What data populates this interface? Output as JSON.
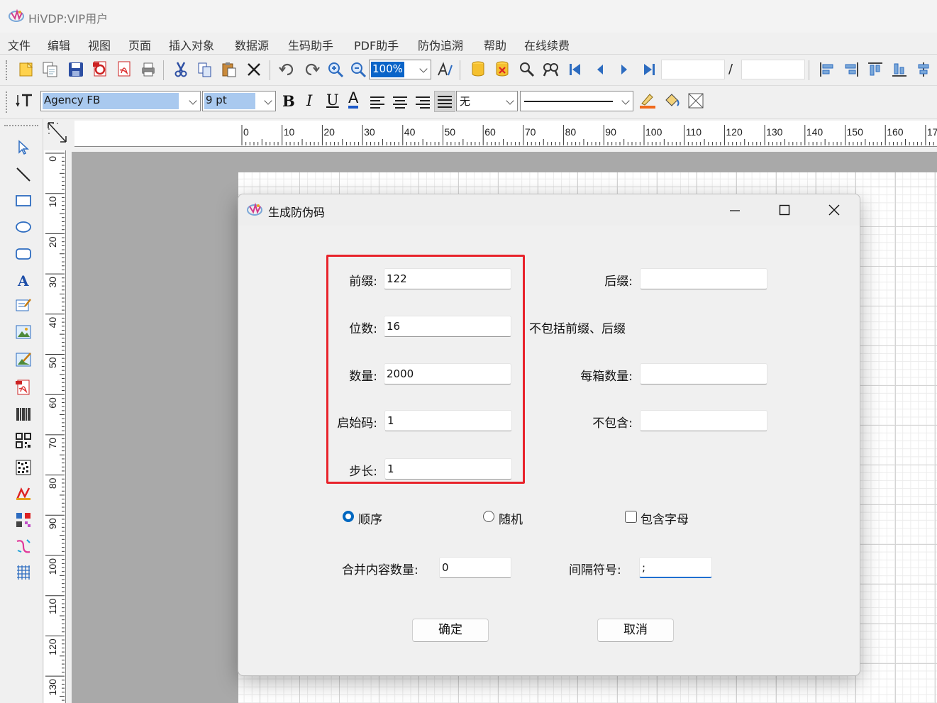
{
  "app": {
    "title": "HiVDP:VIP用户"
  },
  "menu": [
    "文件",
    "编辑",
    "视图",
    "页面",
    "插入对象",
    "数据源",
    "生码助手",
    "PDF助手",
    "防伪追溯",
    "帮助",
    "在线续费"
  ],
  "toolbar": {
    "zoom": "100%",
    "page_separator": "/",
    "font_name": "Agency FB",
    "font_size": "9 pt",
    "bold": "B",
    "italic": "I",
    "underline": "U",
    "font_color": "A",
    "border_style": "无"
  },
  "ruler": {
    "horizontal": [
      "0",
      "10",
      "20",
      "30",
      "40",
      "50",
      "60",
      "70",
      "80",
      "90",
      "100",
      "110",
      "120",
      "130",
      "140",
      "150",
      "160",
      "17"
    ],
    "vertical": [
      "0",
      "10",
      "20",
      "30",
      "40",
      "50",
      "60",
      "70",
      "80",
      "90",
      "100",
      "110",
      "120",
      "130"
    ]
  },
  "dialog": {
    "title": "生成防伪码",
    "prefix_label": "前缀:",
    "prefix_value": "122",
    "suffix_label": "后缀:",
    "suffix_value": "",
    "digits_label": "位数:",
    "digits_value": "16",
    "digits_note": "不包括前缀、后缀",
    "quantity_label": "数量:",
    "quantity_value": "2000",
    "per_box_label": "每箱数量:",
    "per_box_value": "",
    "start_label": "启始码:",
    "start_value": "1",
    "exclude_label": "不包含:",
    "exclude_value": "",
    "step_label": "步长:",
    "step_value": "1",
    "order_sequential": "顺序",
    "order_random": "随机",
    "include_letters": "包含字母",
    "merge_label": "合并内容数量:",
    "merge_value": "0",
    "separator_label": "间隔符号:",
    "separator_value": ";",
    "ok": "确定",
    "cancel": "取消"
  },
  "colors": {
    "highlight_box": "#e8232b",
    "accent": "#0067c0"
  }
}
